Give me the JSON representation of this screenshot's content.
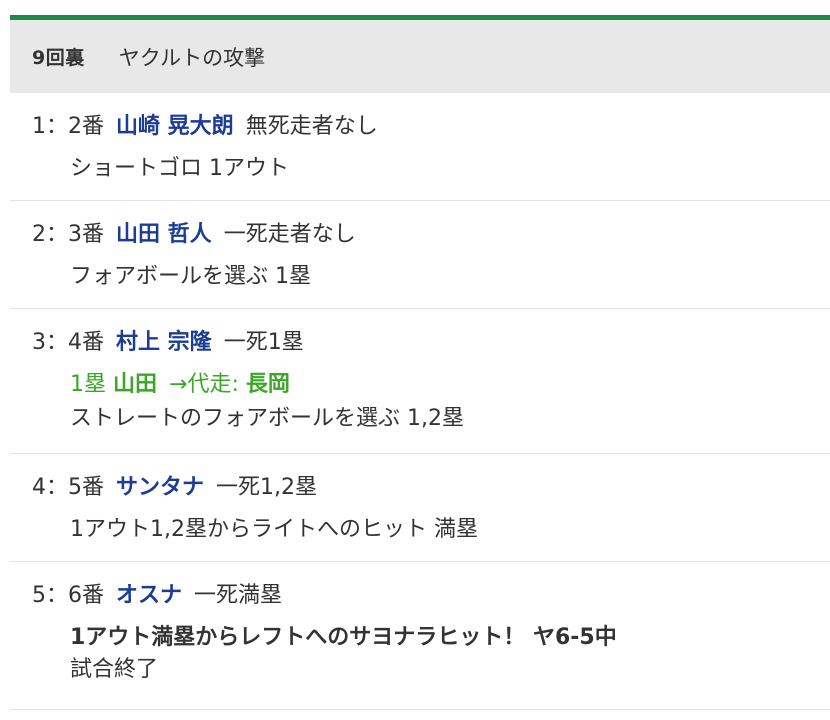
{
  "header": {
    "inning": "9回裏",
    "title": "ヤクルトの攻撃"
  },
  "plays": [
    {
      "pa_no": "1",
      "separator": "：",
      "order": "2番",
      "player": "山崎 晃大朗",
      "situation": "無死走者なし",
      "result": "ショートゴロ 1アウト"
    },
    {
      "pa_no": "2",
      "separator": "：",
      "order": "3番",
      "player": "山田 哲人",
      "situation": "一死走者なし",
      "result": "フォアボールを選ぶ 1塁"
    },
    {
      "pa_no": "3",
      "separator": "：",
      "order": "4番",
      "player": "村上 宗隆",
      "situation": "一死1塁",
      "substitution": {
        "base": "1塁",
        "runner": "山田",
        "arrow_label": "→代走:",
        "replacement": "長岡"
      },
      "result": "ストレートのフォアボールを選ぶ 1,2塁"
    },
    {
      "pa_no": "4",
      "separator": "：",
      "order": "5番",
      "player": "サンタナ",
      "situation": "一死1,2塁",
      "result": "1アウト1,2塁からライトへのヒット 満塁"
    },
    {
      "pa_no": "5",
      "separator": "：",
      "order": "6番",
      "player": "オスナ",
      "situation": "一死満塁",
      "result": "1アウト満塁からレフトへのサヨナラヒット！ ヤ6-5中",
      "result2": "試合終了"
    }
  ],
  "colors": {
    "accent_bar": "#1e8a4a",
    "player_name": "#1d3c96",
    "substitution": "#3aa826",
    "header_bg": "#e8e8e8"
  }
}
